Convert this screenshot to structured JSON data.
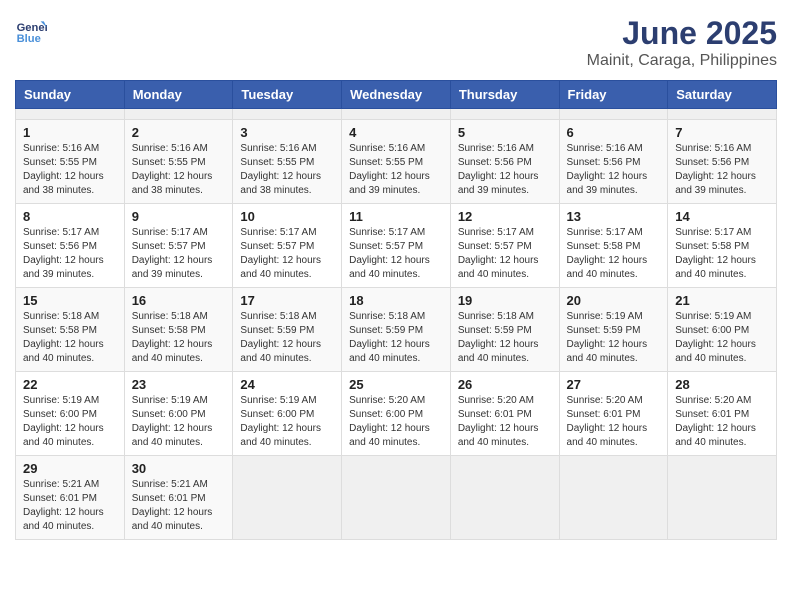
{
  "header": {
    "logo_line1": "General",
    "logo_line2": "Blue",
    "title": "June 2025",
    "subtitle": "Mainit, Caraga, Philippines"
  },
  "calendar": {
    "weekdays": [
      "Sunday",
      "Monday",
      "Tuesday",
      "Wednesday",
      "Thursday",
      "Friday",
      "Saturday"
    ],
    "weeks": [
      [
        {
          "day": "",
          "empty": true
        },
        {
          "day": "",
          "empty": true
        },
        {
          "day": "",
          "empty": true
        },
        {
          "day": "",
          "empty": true
        },
        {
          "day": "",
          "empty": true
        },
        {
          "day": "",
          "empty": true
        },
        {
          "day": "",
          "empty": true
        }
      ],
      [
        {
          "day": "1",
          "sunrise": "5:16 AM",
          "sunset": "5:55 PM",
          "daylight": "12 hours and 38 minutes."
        },
        {
          "day": "2",
          "sunrise": "5:16 AM",
          "sunset": "5:55 PM",
          "daylight": "12 hours and 38 minutes."
        },
        {
          "day": "3",
          "sunrise": "5:16 AM",
          "sunset": "5:55 PM",
          "daylight": "12 hours and 38 minutes."
        },
        {
          "day": "4",
          "sunrise": "5:16 AM",
          "sunset": "5:55 PM",
          "daylight": "12 hours and 39 minutes."
        },
        {
          "day": "5",
          "sunrise": "5:16 AM",
          "sunset": "5:56 PM",
          "daylight": "12 hours and 39 minutes."
        },
        {
          "day": "6",
          "sunrise": "5:16 AM",
          "sunset": "5:56 PM",
          "daylight": "12 hours and 39 minutes."
        },
        {
          "day": "7",
          "sunrise": "5:16 AM",
          "sunset": "5:56 PM",
          "daylight": "12 hours and 39 minutes."
        }
      ],
      [
        {
          "day": "8",
          "sunrise": "5:17 AM",
          "sunset": "5:56 PM",
          "daylight": "12 hours and 39 minutes."
        },
        {
          "day": "9",
          "sunrise": "5:17 AM",
          "sunset": "5:57 PM",
          "daylight": "12 hours and 39 minutes."
        },
        {
          "day": "10",
          "sunrise": "5:17 AM",
          "sunset": "5:57 PM",
          "daylight": "12 hours and 40 minutes."
        },
        {
          "day": "11",
          "sunrise": "5:17 AM",
          "sunset": "5:57 PM",
          "daylight": "12 hours and 40 minutes."
        },
        {
          "day": "12",
          "sunrise": "5:17 AM",
          "sunset": "5:57 PM",
          "daylight": "12 hours and 40 minutes."
        },
        {
          "day": "13",
          "sunrise": "5:17 AM",
          "sunset": "5:58 PM",
          "daylight": "12 hours and 40 minutes."
        },
        {
          "day": "14",
          "sunrise": "5:17 AM",
          "sunset": "5:58 PM",
          "daylight": "12 hours and 40 minutes."
        }
      ],
      [
        {
          "day": "15",
          "sunrise": "5:18 AM",
          "sunset": "5:58 PM",
          "daylight": "12 hours and 40 minutes."
        },
        {
          "day": "16",
          "sunrise": "5:18 AM",
          "sunset": "5:58 PM",
          "daylight": "12 hours and 40 minutes."
        },
        {
          "day": "17",
          "sunrise": "5:18 AM",
          "sunset": "5:59 PM",
          "daylight": "12 hours and 40 minutes."
        },
        {
          "day": "18",
          "sunrise": "5:18 AM",
          "sunset": "5:59 PM",
          "daylight": "12 hours and 40 minutes."
        },
        {
          "day": "19",
          "sunrise": "5:18 AM",
          "sunset": "5:59 PM",
          "daylight": "12 hours and 40 minutes."
        },
        {
          "day": "20",
          "sunrise": "5:19 AM",
          "sunset": "5:59 PM",
          "daylight": "12 hours and 40 minutes."
        },
        {
          "day": "21",
          "sunrise": "5:19 AM",
          "sunset": "6:00 PM",
          "daylight": "12 hours and 40 minutes."
        }
      ],
      [
        {
          "day": "22",
          "sunrise": "5:19 AM",
          "sunset": "6:00 PM",
          "daylight": "12 hours and 40 minutes."
        },
        {
          "day": "23",
          "sunrise": "5:19 AM",
          "sunset": "6:00 PM",
          "daylight": "12 hours and 40 minutes."
        },
        {
          "day": "24",
          "sunrise": "5:19 AM",
          "sunset": "6:00 PM",
          "daylight": "12 hours and 40 minutes."
        },
        {
          "day": "25",
          "sunrise": "5:20 AM",
          "sunset": "6:00 PM",
          "daylight": "12 hours and 40 minutes."
        },
        {
          "day": "26",
          "sunrise": "5:20 AM",
          "sunset": "6:01 PM",
          "daylight": "12 hours and 40 minutes."
        },
        {
          "day": "27",
          "sunrise": "5:20 AM",
          "sunset": "6:01 PM",
          "daylight": "12 hours and 40 minutes."
        },
        {
          "day": "28",
          "sunrise": "5:20 AM",
          "sunset": "6:01 PM",
          "daylight": "12 hours and 40 minutes."
        }
      ],
      [
        {
          "day": "29",
          "sunrise": "5:21 AM",
          "sunset": "6:01 PM",
          "daylight": "12 hours and 40 minutes."
        },
        {
          "day": "30",
          "sunrise": "5:21 AM",
          "sunset": "6:01 PM",
          "daylight": "12 hours and 40 minutes."
        },
        {
          "day": "",
          "empty": true
        },
        {
          "day": "",
          "empty": true
        },
        {
          "day": "",
          "empty": true
        },
        {
          "day": "",
          "empty": true
        },
        {
          "day": "",
          "empty": true
        }
      ]
    ]
  }
}
